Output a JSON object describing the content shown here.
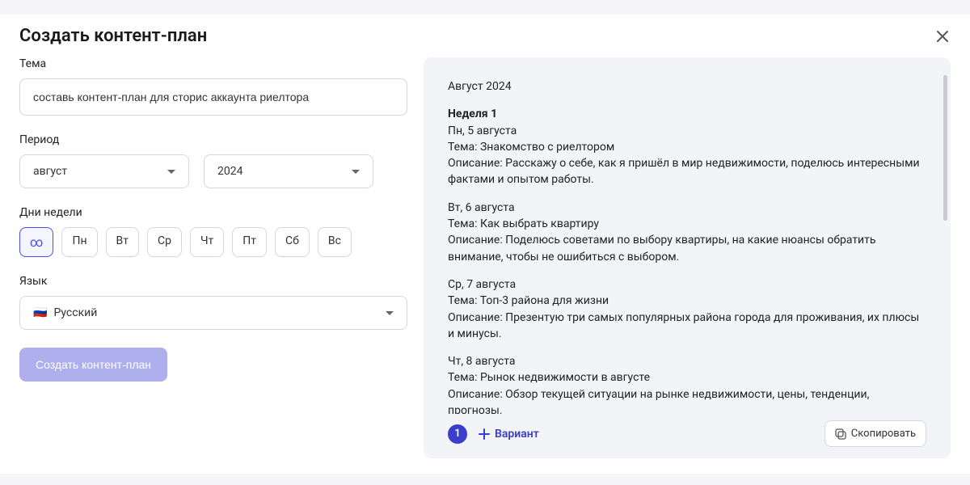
{
  "header": {
    "title": "Создать контент-план"
  },
  "theme": {
    "label": "Тема",
    "value": "составь контент-план для сторис аккаунта риелтора"
  },
  "period": {
    "label": "Период",
    "month": "август",
    "year": "2024"
  },
  "days": {
    "label": "Дни недели",
    "items": [
      "∞",
      "Пн",
      "Вт",
      "Ср",
      "Чт",
      "Пт",
      "Сб",
      "Вс"
    ],
    "selected_index": 0
  },
  "language": {
    "label": "Язык",
    "value": "Русский",
    "flag": "🇷🇺"
  },
  "submit_label": "Создать контент-план",
  "output": {
    "month_header": "Август 2024",
    "week_title": "Неделя 1",
    "entries": [
      {
        "date": "Пн, 5 августа",
        "topic": "Тема: Знакомство с риелтором",
        "desc": "Описание: Расскажу о себе, как я пришёл в мир недвижимости, поделюсь интересными фактами и опытом работы."
      },
      {
        "date": "Вт, 6 августа",
        "topic": "Тема: Как выбрать квартиру",
        "desc": "Описание: Поделюсь советами по выбору квартиры, на какие нюансы обратить внимание, чтобы не ошибиться с выбором."
      },
      {
        "date": "Ср, 7 августа",
        "topic": "Тема: Топ-3 района для жизни",
        "desc": "Описание: Презентую три самых популярных района города для проживания, их плюсы и минусы."
      },
      {
        "date": "Чт, 8 августа",
        "topic": "Тема: Рынок недвижимости в августе",
        "desc": "Описание: Обзор текущей ситуации на рынке недвижимости, цены, тенденции, прогнозы."
      }
    ]
  },
  "footer": {
    "variant_number": "1",
    "add_variant_label": "Вариант",
    "copy_label": "Скопировать"
  }
}
